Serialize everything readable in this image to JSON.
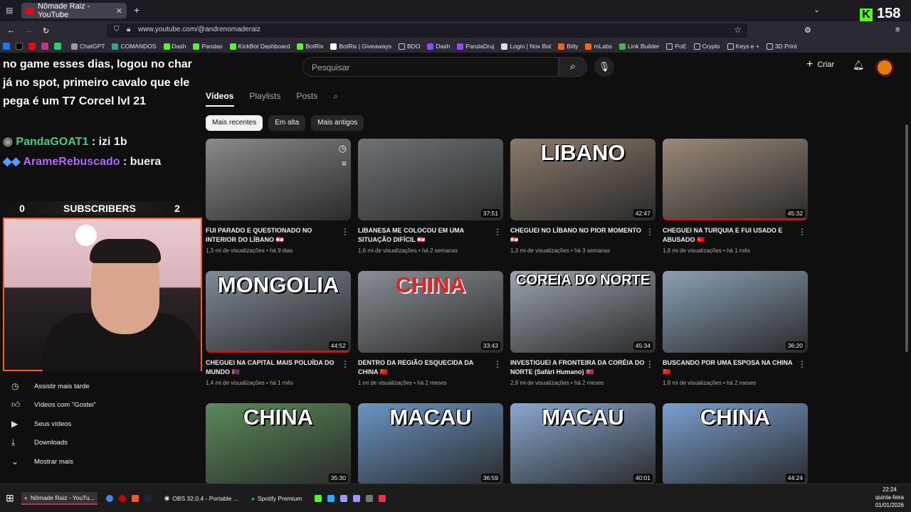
{
  "browser": {
    "tab_title": "Nômade Raiz - YouTube",
    "url": "www.youtube.com/@andrenomaderaiz",
    "bookmarks": [
      "ChatGPT",
      "COMANDOS",
      "Dash",
      "Pandao",
      "KickBot Dashboard",
      "BotRix",
      "BotRix | Giveaways",
      "BDO",
      "Dash",
      "PandaDruj",
      "Login | Nox Bot",
      "Bitly",
      "mLabs",
      "Link Builder",
      "PoE",
      "Crypto",
      "Keys e +",
      "3D Print"
    ],
    "kick_count": "158"
  },
  "header": {
    "search_placeholder": "Pesquisar",
    "create_label": "Criar"
  },
  "channel_tabs": [
    "Vídeos",
    "Playlists",
    "Posts"
  ],
  "chips": [
    "Mais recentes",
    "Em alta",
    "Mais antigos"
  ],
  "videos": [
    {
      "title": "FUI PARADO E QUESTIONADO NO INTERIOR DO LÍBANO 🇱🇧",
      "meta": "1,3 mi de visualizações • há 9 dias",
      "duration": "",
      "overlay": "",
      "progress": 0.0
    },
    {
      "title": "LIBANESA ME COLOCOU EM UMA SITUAÇÃO DIFÍCIL 🇱🇧",
      "meta": "1,6 mi de visualizações • há 2 semanas",
      "duration": "37:51",
      "overlay": "",
      "progress": 0.0
    },
    {
      "title": "CHEGUEI NO LÍBANO NO PIOR MOMENTO 🇱🇧",
      "meta": "1,3 mi de visualizações • há 3 semanas",
      "duration": "42:47",
      "overlay": "LIBANO",
      "progress": 0.0
    },
    {
      "title": "CHEGUEI NA TURQUIA E FUI USADO E ABUSADO 🇹🇷",
      "meta": "1,8 mi de visualizações • há 1 mês",
      "duration": "45:32",
      "overlay": "",
      "progress": 1.0
    },
    {
      "title": "CHEGUEI NA CAPITAL MAIS POLUÍDA DO MUNDO 🇲🇳",
      "meta": "1,4 mi de visualizações • há 1 mês",
      "duration": "44:52",
      "overlay": "MONGOLIA",
      "progress": 1.0
    },
    {
      "title": "DENTRO DA REGIÃO ESQUECIDA DA CHINA 🇨🇳",
      "meta": "1 mi de visualizações • há 2 meses",
      "duration": "33:43",
      "overlay": "CHINA",
      "progress": 0.0
    },
    {
      "title": "INVESTIGUEI A FRONTEIRA DA CORÉIA DO NORTE (Safári Humano) 🇰🇵",
      "meta": "2,9 mi de visualizações • há 2 meses",
      "duration": "45:34",
      "overlay": "COREIA DO NORTE",
      "progress": 0.0
    },
    {
      "title": "BUSCANDO POR UMA ESPOSA NA CHINA 🇨🇳",
      "meta": "1,8 mi de visualizações • há 2 meses",
      "duration": "36:20",
      "overlay": "",
      "progress": 0.0
    },
    {
      "title": "",
      "meta": "",
      "duration": "35:30",
      "overlay": "CHINA",
      "progress": 0.0
    },
    {
      "title": "",
      "meta": "",
      "duration": "36:59",
      "overlay": "MACAU",
      "progress": 0.0
    },
    {
      "title": "",
      "meta": "",
      "duration": "40:01",
      "overlay": "MACAU",
      "progress": 0.0
    },
    {
      "title": "",
      "meta": "",
      "duration": "44:24",
      "overlay": "CHINA",
      "progress": 0.0
    }
  ],
  "sidebar": [
    {
      "label": "Assistir mais tarde",
      "icon": "clock-icon"
    },
    {
      "label": "Vídeos com \"Gostei\"",
      "icon": "thumbs-up-icon"
    },
    {
      "label": "Seus vídeos",
      "icon": "play-square-icon"
    },
    {
      "label": "Downloads",
      "icon": "download-icon"
    },
    {
      "label": "Mostrar mais",
      "icon": "chevron-down-icon"
    }
  ],
  "stream_overlay": {
    "chat_text": "no game esses dias, logou no char já no spot, primeiro cavalo que ele pega é um T7 Corcel lvl 21",
    "chat_user1": "PandaGOAT1",
    "chat_msg1": ": izi 1b",
    "chat_user2": "ArameRebuscado",
    "chat_msg2": ": buera",
    "subs_left": "0",
    "subs_label": "SUBSCRIBERS",
    "subs_right": "2"
  },
  "taskbar": {
    "apps": [
      "Nômade Raiz - YouTu...",
      "OBS 32.0.4 - Portable ...",
      "Spotify Premium"
    ],
    "time": "22:24",
    "day": "quinta-feira",
    "date": "01/01/2026"
  },
  "colors": {
    "yt_red": "#ff0000",
    "kick_green": "#53fc18",
    "webcam_border": "#ff5a1f"
  }
}
